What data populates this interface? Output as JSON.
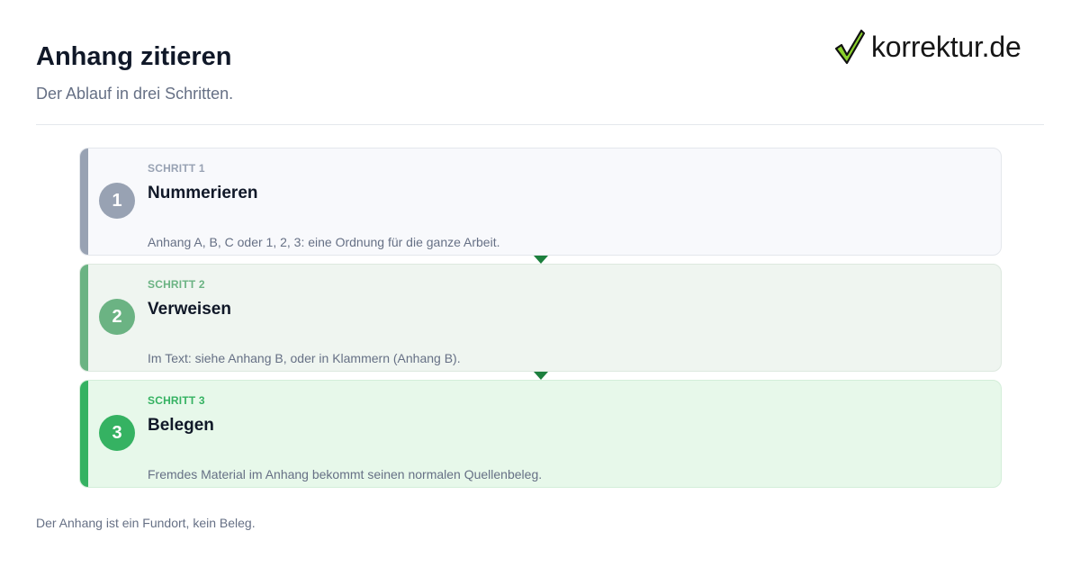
{
  "header": {
    "title": "Anhang zitieren",
    "subtitle": "Der Ablauf in drei Schritten."
  },
  "logo": {
    "text": "korrektur.de",
    "icon": "checkmark-icon",
    "colors": {
      "check_fill": "#8bd12c",
      "check_outline": "#111111"
    }
  },
  "steps": [
    {
      "number": "1",
      "kicker": "SCHRITT 1",
      "title": "Nummerieren",
      "description": "Anhang A, B, C oder 1, 2, 3: eine Ordnung für die ganze Arbeit.",
      "accent": "#98a2b3"
    },
    {
      "number": "2",
      "kicker": "SCHRITT 2",
      "title": "Verweisen",
      "description": "Im Text: siehe Anhang B, oder in Klammern (Anhang B).",
      "accent": "#6bb383"
    },
    {
      "number": "3",
      "kicker": "SCHRITT 3",
      "title": "Belegen",
      "description": "Fremdes Material im Anhang bekommt seinen normalen Quellenbeleg.",
      "accent": "#35b262"
    }
  ],
  "connector_color": "#1c7f3d",
  "footnote": "Der Anhang ist ein Fundort, kein Beleg."
}
